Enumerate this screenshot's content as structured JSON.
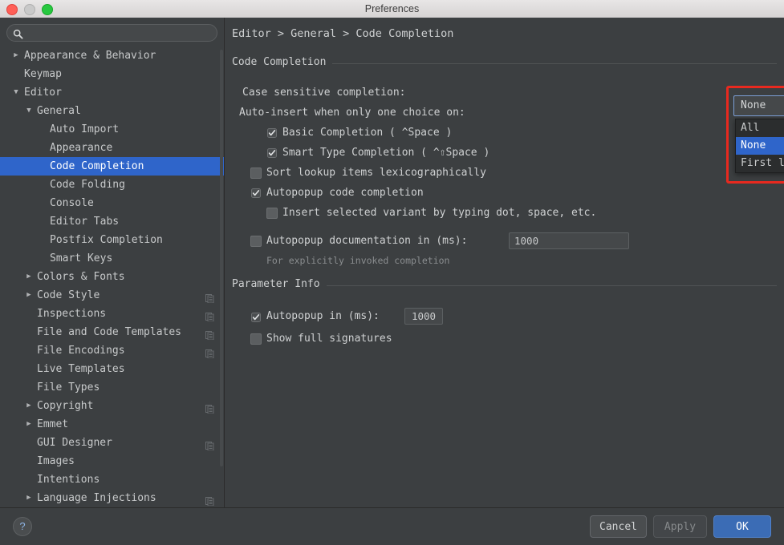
{
  "window": {
    "title": "Preferences",
    "controls": [
      "close",
      "minimize",
      "zoom"
    ]
  },
  "search": {
    "value": "",
    "placeholder": "",
    "icon": "search-icon"
  },
  "sidebar": {
    "items": [
      {
        "label": "Appearance & Behavior",
        "indent": 0,
        "twisty": "collapsed",
        "selected": false,
        "cfg": false
      },
      {
        "label": "Keymap",
        "indent": 0,
        "twisty": "none",
        "selected": false,
        "cfg": false
      },
      {
        "label": "Editor",
        "indent": 0,
        "twisty": "expanded",
        "selected": false,
        "cfg": false
      },
      {
        "label": "General",
        "indent": 1,
        "twisty": "expanded",
        "selected": false,
        "cfg": false
      },
      {
        "label": "Auto Import",
        "indent": 2,
        "twisty": "none",
        "selected": false,
        "cfg": false
      },
      {
        "label": "Appearance",
        "indent": 2,
        "twisty": "none",
        "selected": false,
        "cfg": false
      },
      {
        "label": "Code Completion",
        "indent": 2,
        "twisty": "none",
        "selected": true,
        "cfg": false
      },
      {
        "label": "Code Folding",
        "indent": 2,
        "twisty": "none",
        "selected": false,
        "cfg": false
      },
      {
        "label": "Console",
        "indent": 2,
        "twisty": "none",
        "selected": false,
        "cfg": false
      },
      {
        "label": "Editor Tabs",
        "indent": 2,
        "twisty": "none",
        "selected": false,
        "cfg": false
      },
      {
        "label": "Postfix Completion",
        "indent": 2,
        "twisty": "none",
        "selected": false,
        "cfg": false
      },
      {
        "label": "Smart Keys",
        "indent": 2,
        "twisty": "none",
        "selected": false,
        "cfg": false
      },
      {
        "label": "Colors & Fonts",
        "indent": 1,
        "twisty": "collapsed",
        "selected": false,
        "cfg": false
      },
      {
        "label": "Code Style",
        "indent": 1,
        "twisty": "collapsed",
        "selected": false,
        "cfg": true
      },
      {
        "label": "Inspections",
        "indent": 1,
        "twisty": "none",
        "selected": false,
        "cfg": true
      },
      {
        "label": "File and Code Templates",
        "indent": 1,
        "twisty": "none",
        "selected": false,
        "cfg": true
      },
      {
        "label": "File Encodings",
        "indent": 1,
        "twisty": "none",
        "selected": false,
        "cfg": true
      },
      {
        "label": "Live Templates",
        "indent": 1,
        "twisty": "none",
        "selected": false,
        "cfg": false
      },
      {
        "label": "File Types",
        "indent": 1,
        "twisty": "none",
        "selected": false,
        "cfg": false
      },
      {
        "label": "Copyright",
        "indent": 1,
        "twisty": "collapsed",
        "selected": false,
        "cfg": true
      },
      {
        "label": "Emmet",
        "indent": 1,
        "twisty": "collapsed",
        "selected": false,
        "cfg": false
      },
      {
        "label": "GUI Designer",
        "indent": 1,
        "twisty": "none",
        "selected": false,
        "cfg": true
      },
      {
        "label": "Images",
        "indent": 1,
        "twisty": "none",
        "selected": false,
        "cfg": false
      },
      {
        "label": "Intentions",
        "indent": 1,
        "twisty": "none",
        "selected": false,
        "cfg": false
      },
      {
        "label": "Language Injections",
        "indent": 1,
        "twisty": "collapsed",
        "selected": false,
        "cfg": true
      }
    ]
  },
  "main": {
    "breadcrumb": "Editor > General > Code Completion",
    "sections": [
      {
        "id": "code_completion",
        "title": "Code Completion"
      },
      {
        "id": "parameter_info",
        "title": "Parameter Info"
      }
    ],
    "code_completion": {
      "case_sensitive_label": "Case sensitive completion:",
      "case_sensitive_value": "None",
      "case_sensitive_options": [
        "All",
        "None",
        "First letter"
      ],
      "case_sensitive_highlighted": "None",
      "auto_insert_label": "Auto-insert when only one choice on:",
      "basic_completion_label": "Basic Completion ( ^Space )",
      "basic_completion_checked": true,
      "smart_type_label": "Smart Type Completion ( ^⇧Space )",
      "smart_type_checked": true,
      "sort_lookup_label": "Sort lookup items lexicographically",
      "sort_lookup_checked": false,
      "autopopup_code_label": "Autopopup code completion",
      "autopopup_code_checked": true,
      "insert_variant_label": "Insert selected variant by typing dot, space, etc.",
      "insert_variant_checked": false,
      "autopopup_doc_label": "Autopopup documentation in (ms):",
      "autopopup_doc_checked": false,
      "autopopup_doc_value": "1000",
      "autopopup_doc_hint": "For explicitly invoked completion"
    },
    "parameter_info": {
      "autopopup_label": "Autopopup in (ms):",
      "autopopup_checked": true,
      "autopopup_value": "1000",
      "show_signatures_label": "Show full signatures",
      "show_signatures_checked": false
    }
  },
  "footer": {
    "help_label": "?",
    "cancel_label": "Cancel",
    "apply_label": "Apply",
    "apply_enabled": false,
    "ok_label": "OK"
  },
  "colors": {
    "window_bg": "#3c3f41",
    "selection_blue": "#2f65ca",
    "primary_button": "#3b6cb5",
    "annotation_red": "#e8291f",
    "text": "#cfd1d2",
    "dim_text": "#8a8d8f"
  }
}
